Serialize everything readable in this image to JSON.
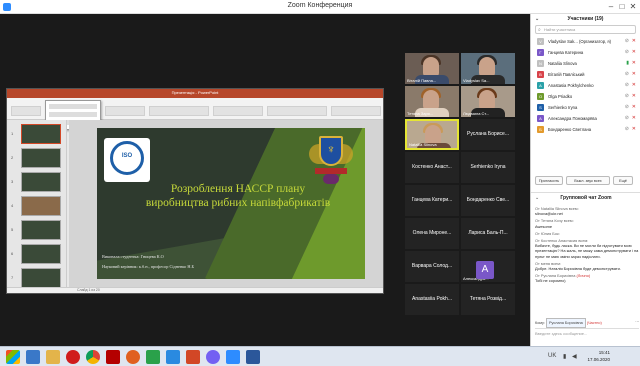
{
  "window": {
    "title": "Zoom Конференция"
  },
  "powerpoint": {
    "doc_title": "Презентація - PowerPoint",
    "thumb_numbers": [
      "1",
      "2",
      "3",
      "4",
      "5",
      "6",
      "7"
    ],
    "slide": {
      "title": "Розроблення НАССР плану виробництва рибних напівфабрикатів",
      "author": "Виконала студентка: Гницева К.О",
      "supervisor": "Науковий керівник: к.б.н., професор Сідненко Н.Б",
      "iso_text": "ISO"
    },
    "status_text": "Слайд 1 из 20"
  },
  "videos": [
    {
      "name": "Віталій Павла...",
      "type": "video"
    },
    {
      "name": "Vladyslav Sa...",
      "type": "video"
    },
    {
      "name": "Тетяна Заря...",
      "type": "video"
    },
    {
      "name": "Людмила Ст...",
      "type": "video"
    },
    {
      "name": "Nataliia Slinova",
      "type": "video",
      "selected": true
    },
    {
      "name": "Руслана Борисе...",
      "type": "name"
    },
    {
      "name": "Костенко Анаст...",
      "type": "name"
    },
    {
      "name": "Serhienko Iryna",
      "type": "name"
    },
    {
      "name": "Ганцева Катери...",
      "type": "name"
    },
    {
      "name": "Бондаренко Све...",
      "type": "name"
    },
    {
      "name": "Олена Мироне...",
      "type": "name"
    },
    {
      "name": "Лариса Баль-П...",
      "type": "name"
    },
    {
      "name": "Варвара Солод...",
      "type": "name"
    },
    {
      "name": "Александра...",
      "type": "avatar",
      "initial": "A"
    },
    {
      "name": "Anastasiia Pokh...",
      "type": "name"
    },
    {
      "name": "Тетяна Розвід...",
      "type": "name"
    }
  ],
  "participants_panel": {
    "title": "Участники (19)",
    "search_placeholder": "Найти участника",
    "participants": [
      {
        "name": "Vladyslav Sak... (Организатор, я)",
        "initial": "V",
        "color": "#c0c0c0"
      },
      {
        "name": "Ганцева Катерина",
        "initial": "Г",
        "color": "#7a57c8"
      },
      {
        "name": "Nataliia Slinova",
        "initial": "N",
        "color": "#c0c0c0"
      },
      {
        "name": "Віталій Павліський",
        "initial": "В",
        "color": "#d8434a"
      },
      {
        "name": "Anastasia Pokhylchenko",
        "initial": "A",
        "color": "#2aa1a8"
      },
      {
        "name": "Olga Priadko",
        "initial": "O",
        "color": "#6e9a2c"
      },
      {
        "name": "Serhienko Iryna",
        "initial": "S",
        "color": "#1e5fa8"
      },
      {
        "name": "Александра Пономарёва",
        "initial": "A",
        "color": "#7a57c8"
      },
      {
        "name": "Бондаренко Светлана",
        "initial": "Б",
        "color": "#e39a2c"
      }
    ],
    "buttons": [
      "Пригласить",
      "Выкл. звук всех",
      "Ещё"
    ]
  },
  "chat": {
    "title": "Групповой чат Zoom",
    "messages": [
      {
        "from": "От Nataliia Slinova всем:",
        "text": "slinova@ukr.net"
      },
      {
        "from": "От Тетяна Кочу всем:",
        "text": "Awesome"
      },
      {
        "from": "От Юлия Бок:",
        "text": ""
      },
      {
        "from": "От Костенко Анастасия всем:",
        "text": "Вибачте, будь ласка. Ви не могли би підготувати мою презентацію? На жаль, не можу сама демонструвати і на пульт не маю зміни зараз надіслати."
      },
      {
        "from": "От меня всем:",
        "text": "Добре. Наталія Борисівна буде демонструвати."
      },
      {
        "from": "От Руслана Борисівна",
        "private": "(Лично)",
        "text": "Тобі не соромно)"
      }
    ],
    "to_label": "Кому:",
    "to_value": "Руслана Борисівна",
    "to_private": "(Частно)",
    "input_placeholder": "Введите здесь сообщение..."
  },
  "taskbar": {
    "time": "15:41",
    "date": "17.06.2020",
    "lang": "UK"
  }
}
